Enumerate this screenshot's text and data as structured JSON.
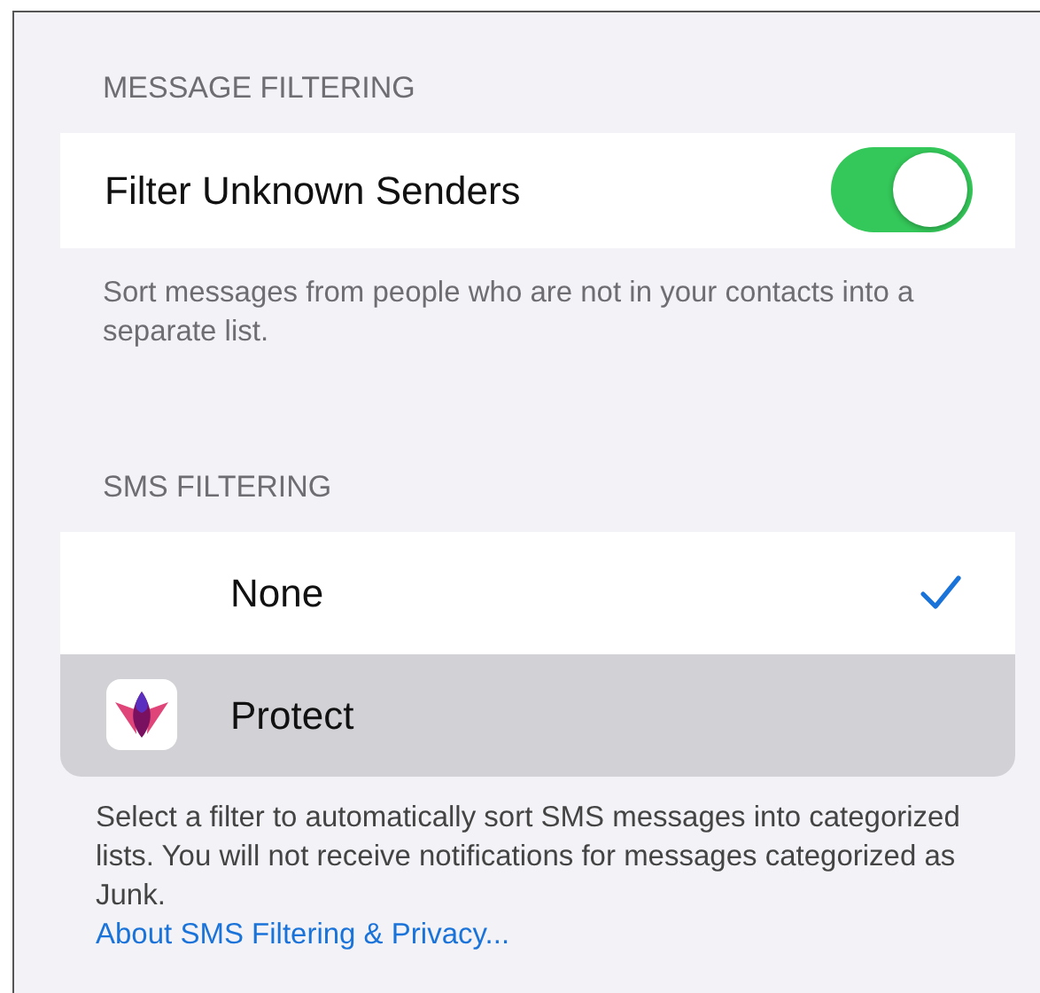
{
  "message_filtering": {
    "header": "MESSAGE FILTERING",
    "toggle": {
      "label": "Filter Unknown Senders",
      "on": true
    },
    "description": "Sort messages from people who are not in your contacts into a separate list."
  },
  "sms_filtering": {
    "header": "SMS FILTERING",
    "options": [
      {
        "label": "None",
        "kind": "plain",
        "selected": true,
        "highlighted": false
      },
      {
        "label": "Protect",
        "kind": "app",
        "selected": false,
        "highlighted": true
      }
    ],
    "description": "Select a filter to automatically sort SMS messages into categorized lists. You will not receive notifications for messages categorized as Junk.",
    "link": "About SMS Filtering & Privacy..."
  }
}
